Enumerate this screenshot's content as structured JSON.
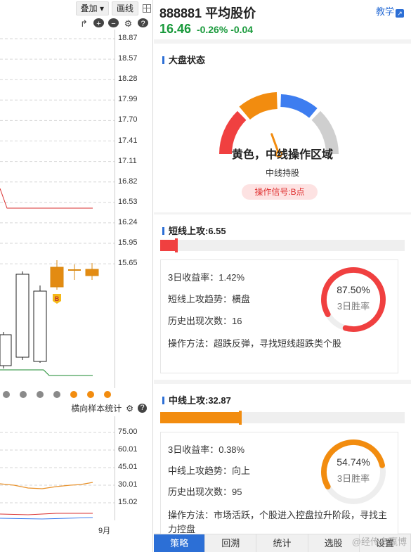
{
  "toolbar": {
    "overlay_label": "叠加 ▾",
    "draw_label": "画线"
  },
  "chart_icons": {
    "refresh": "refresh-icon",
    "zoom_in": "zoom-in-icon",
    "zoom_out": "zoom-out-icon",
    "settings": "gear-icon",
    "help": "help-icon"
  },
  "price_ticks": [
    "18.87",
    "18.57",
    "18.28",
    "17.99",
    "17.70",
    "17.41",
    "17.11",
    "16.82",
    "16.53",
    "16.24",
    "15.95",
    "15.65"
  ],
  "marker_label": "B",
  "sub_chart": {
    "label": "横向样本统计",
    "ticks": [
      "75.00",
      "60.01",
      "45.01",
      "30.01",
      "15.02"
    ],
    "month": "9月"
  },
  "dots": [
    "#8a8a8a",
    "#8a8a8a",
    "#8a8a8a",
    "#8a8a8a",
    "#f28c0f",
    "#f28c0f",
    "#f28c0f"
  ],
  "header": {
    "title": "888881 平均股价",
    "price": "16.46",
    "change_pct": "-0.26%",
    "change": "-0.04",
    "teach_label": "教学"
  },
  "market": {
    "title": "大盘状态",
    "state": "黄色，中线操作区域",
    "sub": "中线持股",
    "signal": "操作信号:B点",
    "colors": {
      "red": "#f04040",
      "orange": "#f28c0f",
      "blue": "#3d7df0",
      "gray": "#cfcfcf"
    }
  },
  "short": {
    "title": "短线上攻:6.55",
    "bar_value": 6.55,
    "bar_color": "#f04040",
    "return_label": "3日收益率：1.42%",
    "trend_label": "短线上攻趋势：横盘",
    "count_label": "历史出现次数：16",
    "method_label": "操作方法：超跌反弹，寻找短线超跌类个股",
    "win_pct": "87.50%",
    "win_value": 87.5,
    "win_label": "3日胜率"
  },
  "mid": {
    "title": "中线上攻:32.87",
    "bar_value": 32.87,
    "bar_color": "#f28c0f",
    "return_label": "3日收益率：0.38%",
    "trend_label": "中线上攻趋势：向上",
    "count_label": "历史出现次数：95",
    "method_label": "操作方法：市场活跃，个股进入控盘拉升阶段，寻找主力控盘",
    "win_pct": "54.74%",
    "win_value": 54.74,
    "win_label": "3日胜率"
  },
  "tabs": [
    "策略",
    "回溯",
    "统计",
    "选股",
    "设置"
  ],
  "watermark": "@经传多赢博"
}
